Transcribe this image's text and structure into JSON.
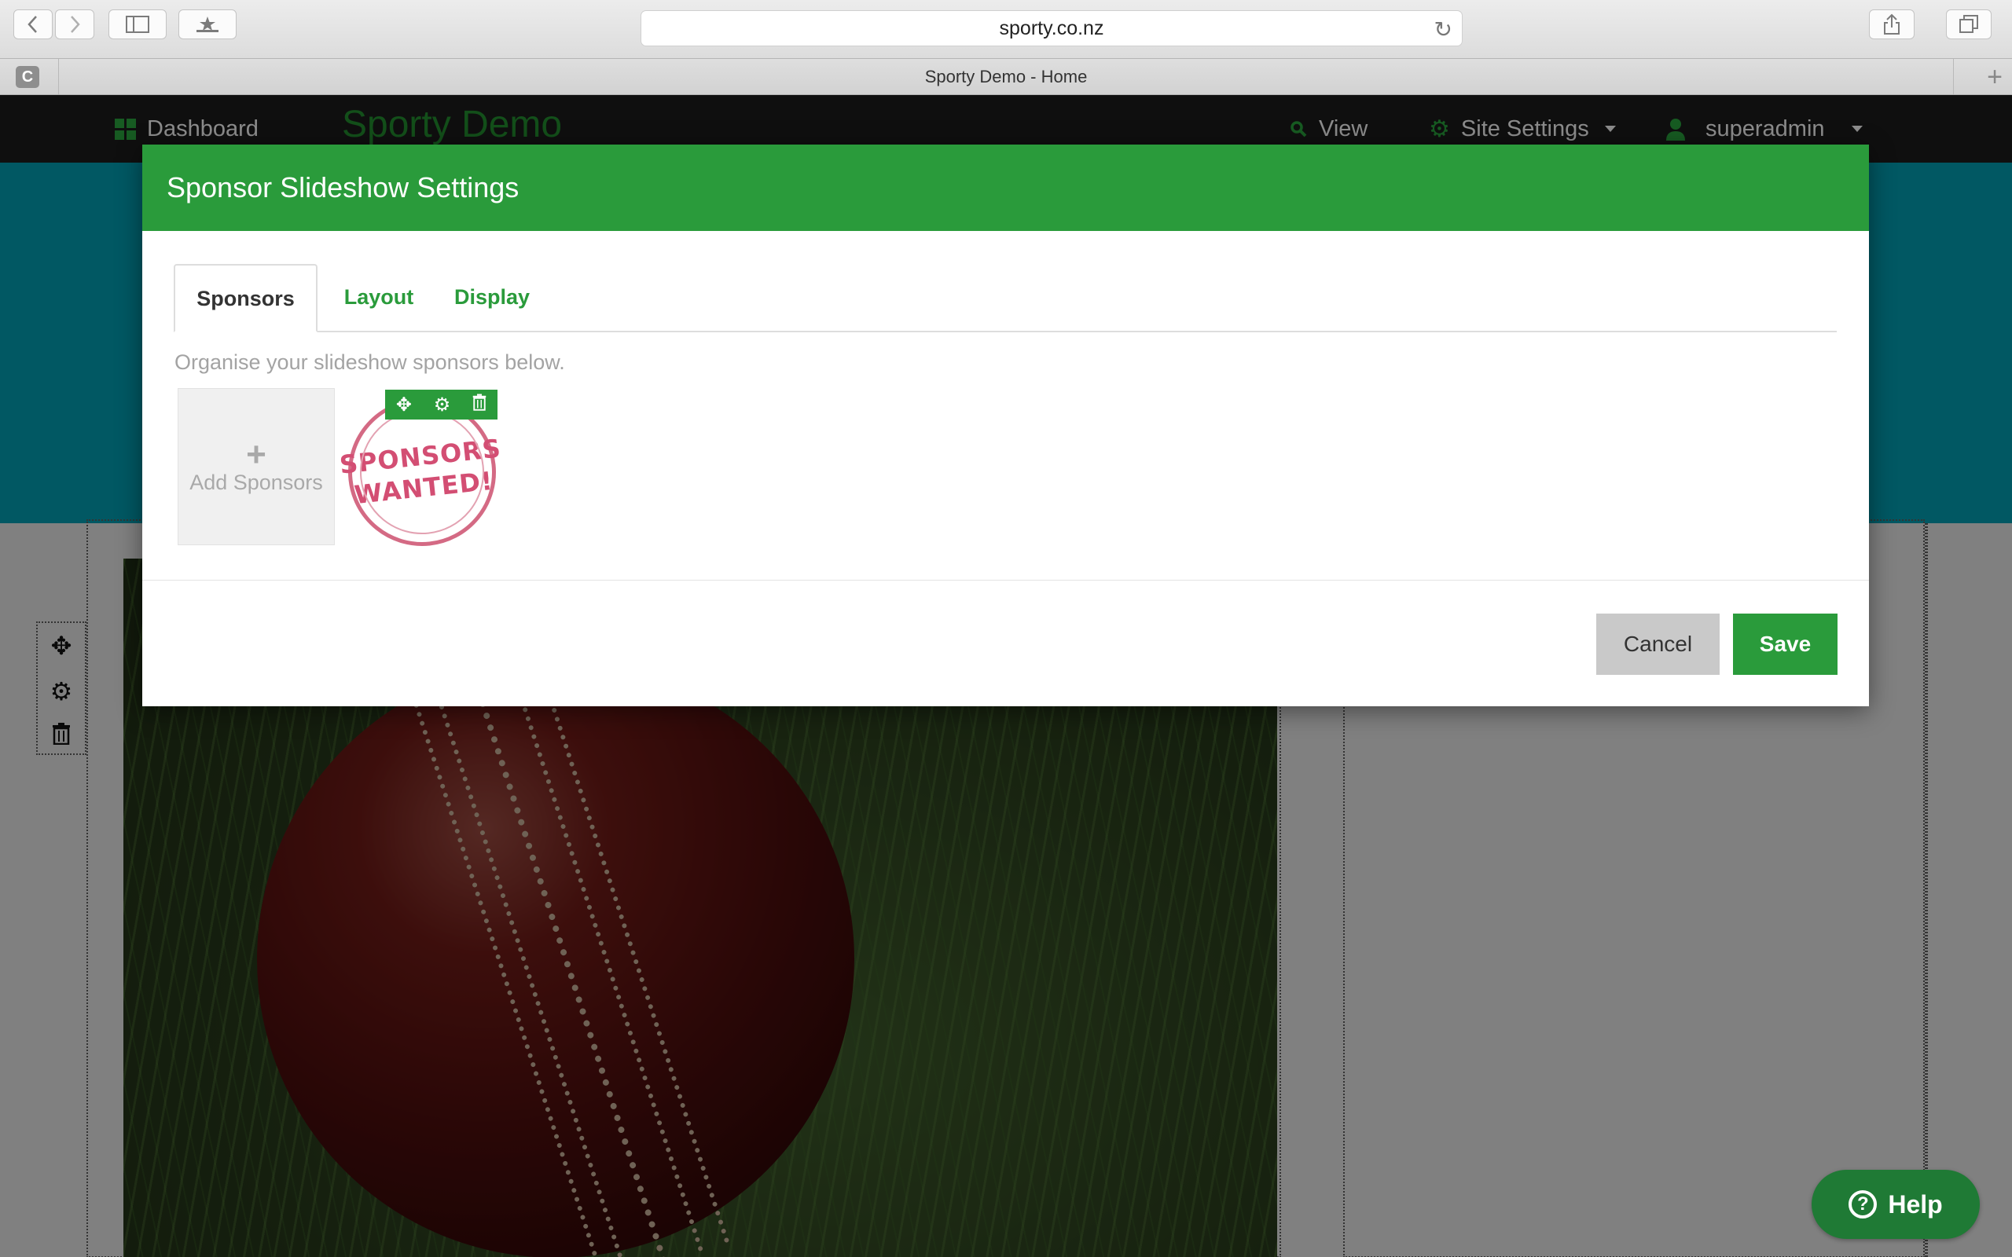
{
  "browser": {
    "url": "sporty.co.nz",
    "tab_letter": "C",
    "tab_title": "Sporty Demo - Home"
  },
  "topnav": {
    "dashboard": "Dashboard",
    "brand": "Sporty Demo",
    "view": "View",
    "site_settings": "Site Settings",
    "user": "superadmin"
  },
  "modal": {
    "title": "Sponsor Slideshow Settings",
    "tabs": [
      {
        "label": "Sponsors",
        "active": true
      },
      {
        "label": "Layout",
        "active": false
      },
      {
        "label": "Display",
        "active": false
      }
    ],
    "hint": "Organise your slideshow sponsors below.",
    "add_label": "Add Sponsors",
    "sponsor_logo_lines": [
      "SPONSORS",
      "WANTED!"
    ],
    "cancel": "Cancel",
    "save": "Save"
  },
  "help": {
    "label": "Help"
  },
  "colors": {
    "brand_green": "#2a9b3b",
    "nav_dark": "#1b1b1b",
    "banner_teal": "#015a66"
  }
}
